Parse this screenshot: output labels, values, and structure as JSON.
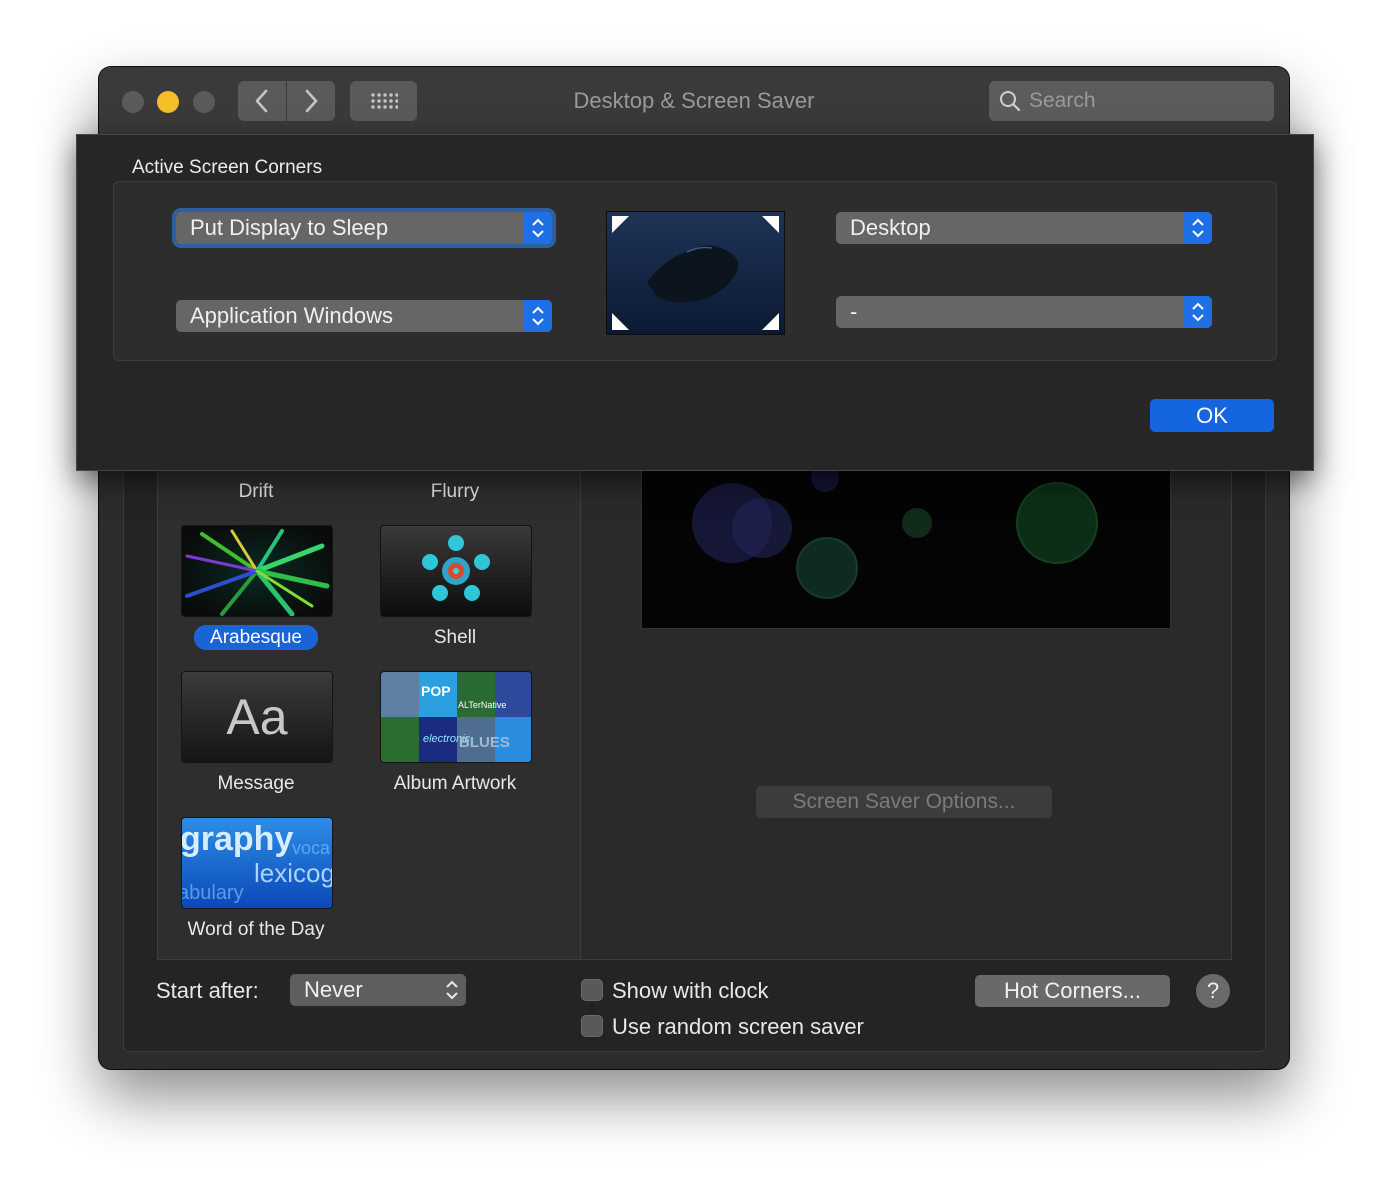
{
  "window": {
    "title": "Desktop & Screen Saver",
    "search_placeholder": "Search"
  },
  "sheet": {
    "title": "Active Screen Corners",
    "corners": {
      "top_left": "Put Display to Sleep",
      "bottom_left": "Application Windows",
      "top_right": "Desktop",
      "bottom_right": "-"
    },
    "ok_label": "OK"
  },
  "screensavers": [
    {
      "name": "Drift",
      "selected": false
    },
    {
      "name": "Flurry",
      "selected": false
    },
    {
      "name": "Arabesque",
      "selected": true
    },
    {
      "name": "Shell",
      "selected": false
    },
    {
      "name": "Message",
      "selected": false
    },
    {
      "name": "Album Artwork",
      "selected": false
    },
    {
      "name": "Word of the Day",
      "selected": false
    }
  ],
  "thumb_text": {
    "message": "Aa",
    "word_of_day": [
      "graphy",
      "voca",
      "lexicog",
      "abulary"
    ],
    "album": [
      "POP",
      "ALTerNative",
      "electronic",
      "BLUES"
    ]
  },
  "options_label": "Screen Saver Options...",
  "bottom": {
    "start_after_label": "Start after:",
    "start_after_value": "Never",
    "show_clock_label": "Show with clock",
    "random_label": "Use random screen saver",
    "hot_corners_label": "Hot Corners...",
    "help_label": "?"
  },
  "colors": {
    "accent": "#1b64d8",
    "minimize": "#f5bf2a"
  }
}
